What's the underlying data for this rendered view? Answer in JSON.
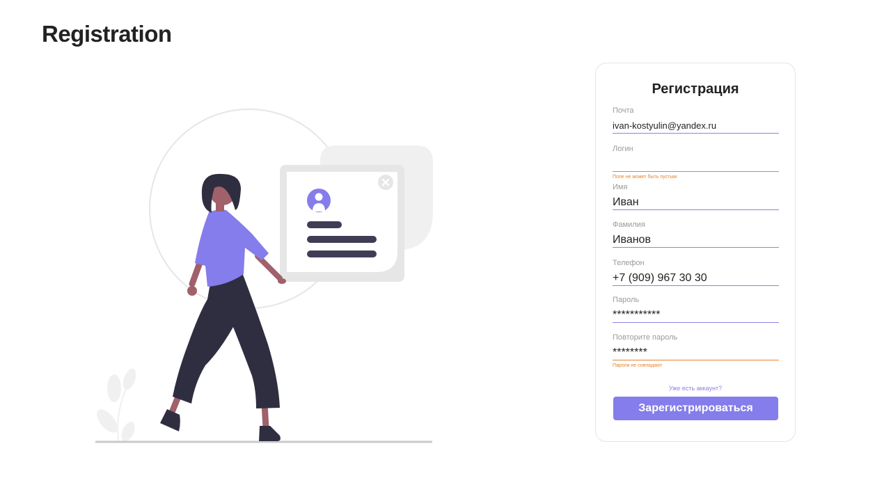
{
  "page": {
    "title": "Registration"
  },
  "form": {
    "title": "Регистрация",
    "fields": [
      {
        "label": "Почта",
        "value": "ivan-kostyulin@yandex.ru",
        "error": ""
      },
      {
        "label": "Логин",
        "value": "",
        "error": "Поле не может быть пустым"
      },
      {
        "label": "Имя",
        "value": "Иван",
        "error": ""
      },
      {
        "label": "Фамилия",
        "value": "Иванов",
        "error": ""
      },
      {
        "label": "Телефон",
        "value": "+7 (909) 967 30 30",
        "error": ""
      },
      {
        "label": "Пароль",
        "value": "***********",
        "error": ""
      },
      {
        "label": "Повторите пароль",
        "value": "********",
        "error": "Пароли не совпадают"
      }
    ],
    "login_link": "Уже есть аккаунт?",
    "submit_label": "Зарегистрироваться"
  },
  "colors": {
    "accent": "#857deb",
    "error": "#e8822a",
    "figure_dark": "#2f2e41",
    "skin": "#a0616a",
    "panel_gray": "#e6e6e6"
  },
  "icons": {
    "illustration": "person-walking-with-profile-card",
    "close": "close-icon",
    "avatar": "user-avatar-icon"
  }
}
